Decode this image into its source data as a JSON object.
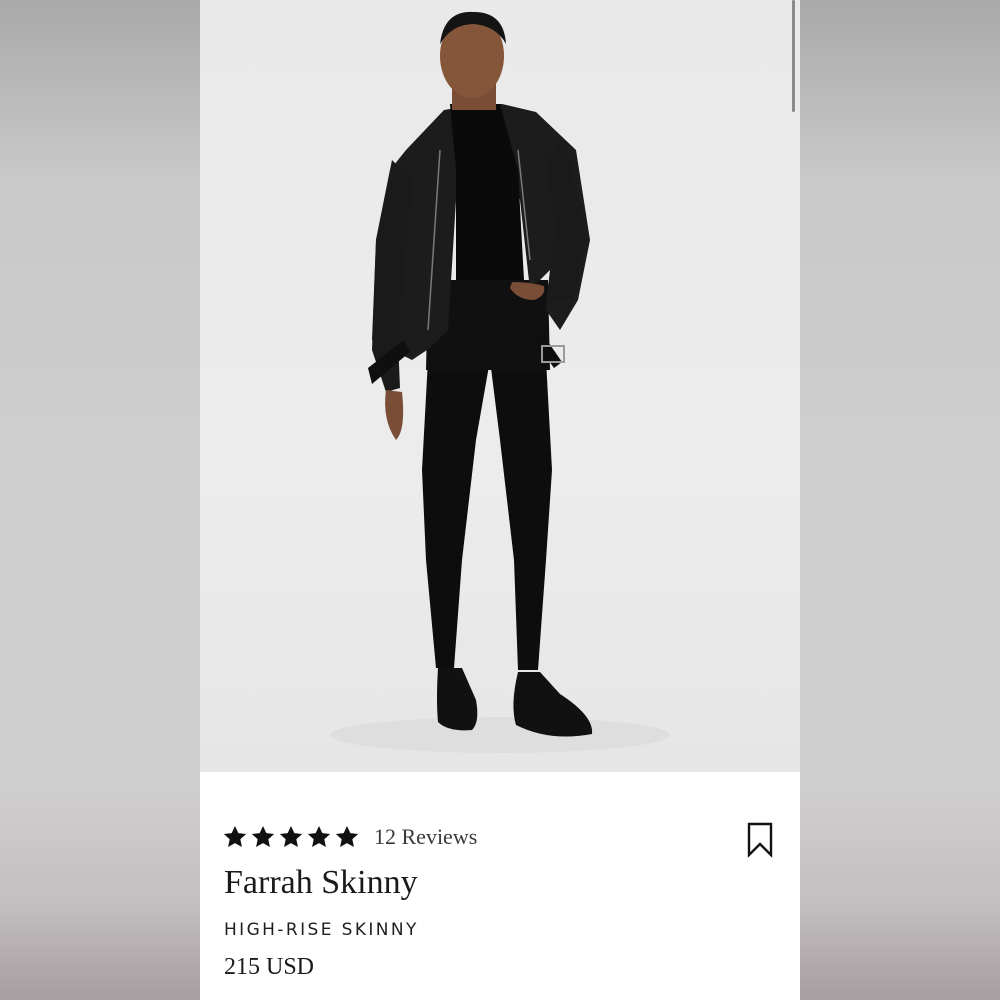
{
  "product": {
    "rating": 5,
    "rating_max": 5,
    "reviews_label": "12 Reviews",
    "name": "Farrah Skinny",
    "subtitle": "HIGH-RISE SKINNY",
    "price": "215 USD",
    "image_alt": "Model wearing black leather moto jacket and black skinny jeans",
    "bookmark_icon": "bookmark-icon",
    "star_icon": "star-icon"
  },
  "colors": {
    "star": "#111111",
    "text": "#1a1a1a",
    "image_bg": "#ebebeb",
    "side_bg": "#c9c9c9"
  }
}
